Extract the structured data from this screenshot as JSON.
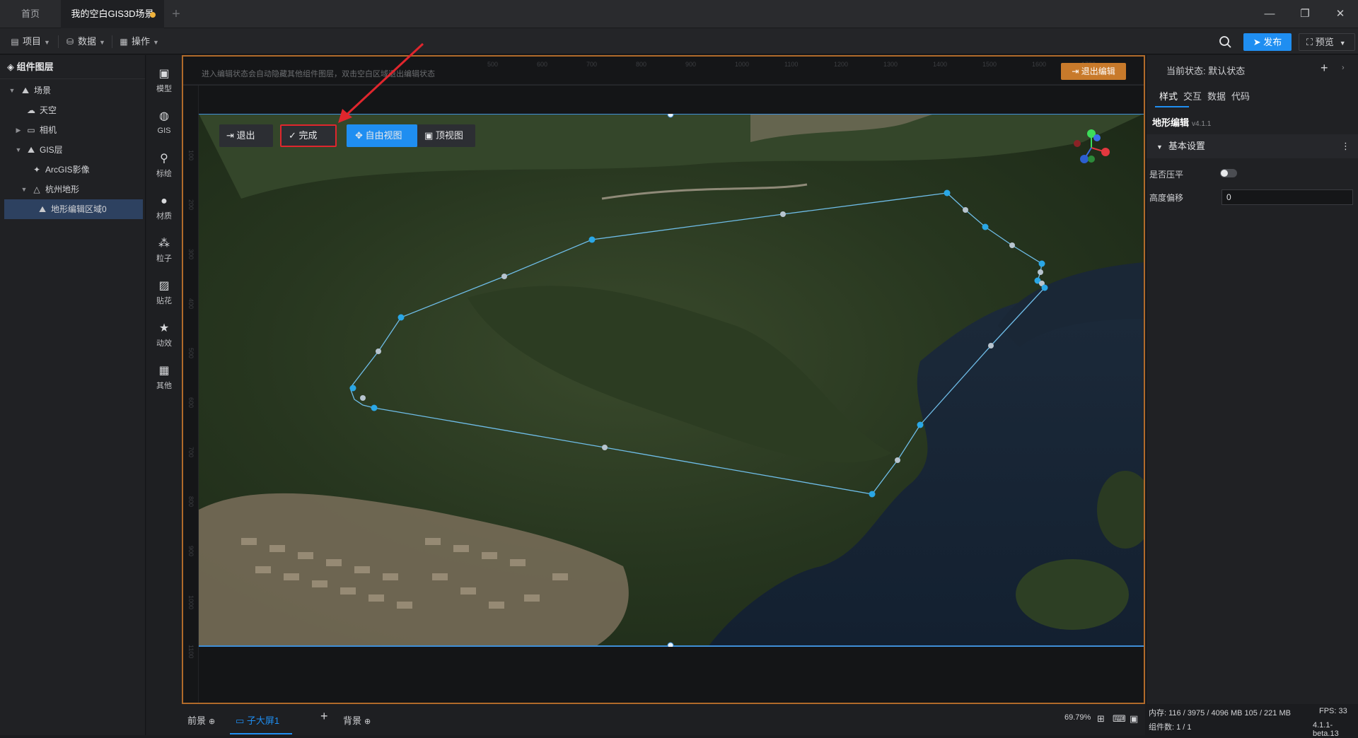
{
  "tabs": {
    "home": "首页",
    "scene": "我的空白GIS3D场景",
    "add": "+"
  },
  "window": {
    "minimize": "—",
    "restore": "❐",
    "close": "✕"
  },
  "menubar": {
    "project": "项目",
    "data": "数据",
    "operate": "操作",
    "publish": "发布",
    "preview": "预览"
  },
  "layers": {
    "title": "组件图层",
    "items": [
      {
        "label": "场景",
        "icon": "scene-icon"
      },
      {
        "label": "天空",
        "icon": "sky-icon"
      },
      {
        "label": "相机",
        "icon": "folder-icon"
      },
      {
        "label": "GIS层",
        "icon": "gis-layer-icon"
      },
      {
        "label": "ArcGIS影像",
        "icon": "imagery-icon"
      },
      {
        "label": "杭州地形",
        "icon": "terrain-icon"
      },
      {
        "label": "地形编辑区域0",
        "icon": "terrain-edit-icon"
      }
    ]
  },
  "tools": [
    {
      "label": "模型",
      "icon": "model-icon"
    },
    {
      "label": "GIS",
      "icon": "globe-icon"
    },
    {
      "label": "标绘",
      "icon": "marker-icon"
    },
    {
      "label": "材质",
      "icon": "material-icon"
    },
    {
      "label": "粒子",
      "icon": "particle-icon"
    },
    {
      "label": "贴花",
      "icon": "decal-icon"
    },
    {
      "label": "动效",
      "icon": "effect-icon"
    },
    {
      "label": "其他",
      "icon": "grid-icon"
    }
  ],
  "canvas": {
    "hint": "进入编辑状态会自动隐藏其他组件图层，双击空白区域退出编辑状态",
    "exit_edit": "退出编辑",
    "map_tools": {
      "exit": "退出",
      "done": "完成",
      "free_view": "自由视图",
      "top_view": "顶视图"
    }
  },
  "bottom": {
    "foreground": "前景",
    "subscreen": "子大屏1",
    "background": "背景",
    "zoom": "69.79%"
  },
  "right_panel": {
    "state_label": "当前状态:  默认状态",
    "tabs": [
      "样式",
      "交互",
      "数据",
      "代码"
    ],
    "component_title": "地形编辑",
    "component_version": "v4.1.1",
    "section": "基本设置",
    "flatten_label": "是否压平",
    "flatten_on": false,
    "height_offset_label": "高度偏移",
    "height_offset_value": "0"
  },
  "status": {
    "memory": "内存:  116 / 3975 / 4096 MB  105 / 221 MB",
    "fps": "FPS:   33",
    "components": "组件数: 1 / 1",
    "version": "4.1.1-beta.13"
  },
  "colors": {
    "accent": "#1f8ef1",
    "canvas_border": "#b06a2a",
    "highlight_box": "#e0262d",
    "exit_edit": "#c87a2b"
  }
}
